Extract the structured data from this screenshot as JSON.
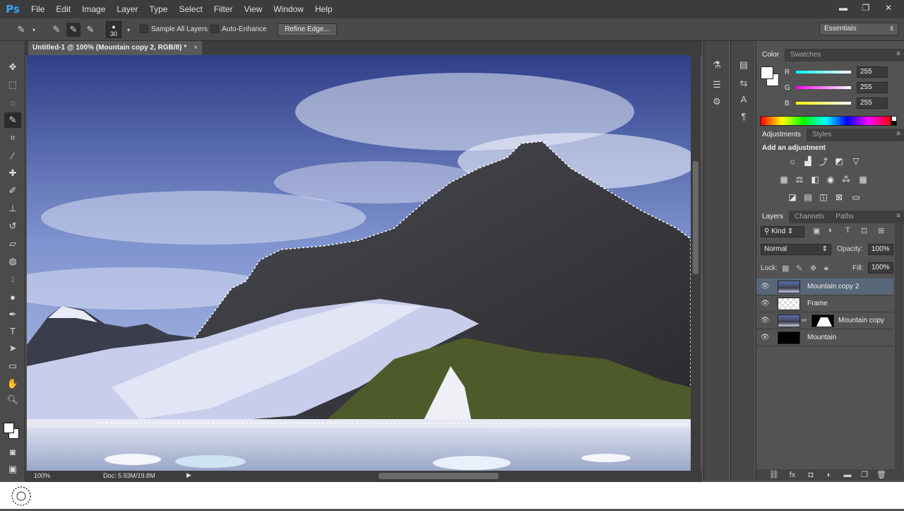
{
  "app": {
    "logo": "Ps"
  },
  "menu": [
    "File",
    "Edit",
    "Image",
    "Layer",
    "Type",
    "Select",
    "Filter",
    "View",
    "Window",
    "Help"
  ],
  "window_controls": {
    "minimize": "▬",
    "restore": "❐",
    "close": "✕"
  },
  "options": {
    "brush_size": "30",
    "sample_all_layers": "Sample All Layers",
    "auto_enhance": "Auto-Enhance",
    "refine_edge": "Refine Edge...",
    "workspace": "Essentials"
  },
  "document": {
    "tab_title": "Untitled-1 @ 100% (Mountain copy 2, RGB/8) *",
    "zoom": "100%",
    "doc_size": "Doc: 5.93M/19.8M"
  },
  "color_panel": {
    "tabs": [
      "Color",
      "Swatches"
    ],
    "channels": [
      {
        "label": "R",
        "value": "255",
        "color": "#3cf"
      },
      {
        "label": "G",
        "value": "255",
        "color": "#f3f"
      },
      {
        "label": "B",
        "value": "255",
        "color": "#ff3"
      }
    ]
  },
  "adjustments_panel": {
    "tabs": [
      "Adjustments",
      "Styles"
    ],
    "heading": "Add an adjustment"
  },
  "layers_panel": {
    "tabs": [
      "Layers",
      "Channels",
      "Paths"
    ],
    "filter_kind": "Kind",
    "blend_mode": "Normal",
    "opacity_label": "Opacity:",
    "opacity": "100%",
    "lock_label": "Lock:",
    "fill_label": "Fill:",
    "fill": "100%",
    "layers": [
      {
        "name": "Mountain copy 2",
        "selected": true
      },
      {
        "name": "Frame",
        "selected": false
      },
      {
        "name": "Mountain copy",
        "selected": false
      },
      {
        "name": "Mountain",
        "selected": false
      }
    ]
  }
}
